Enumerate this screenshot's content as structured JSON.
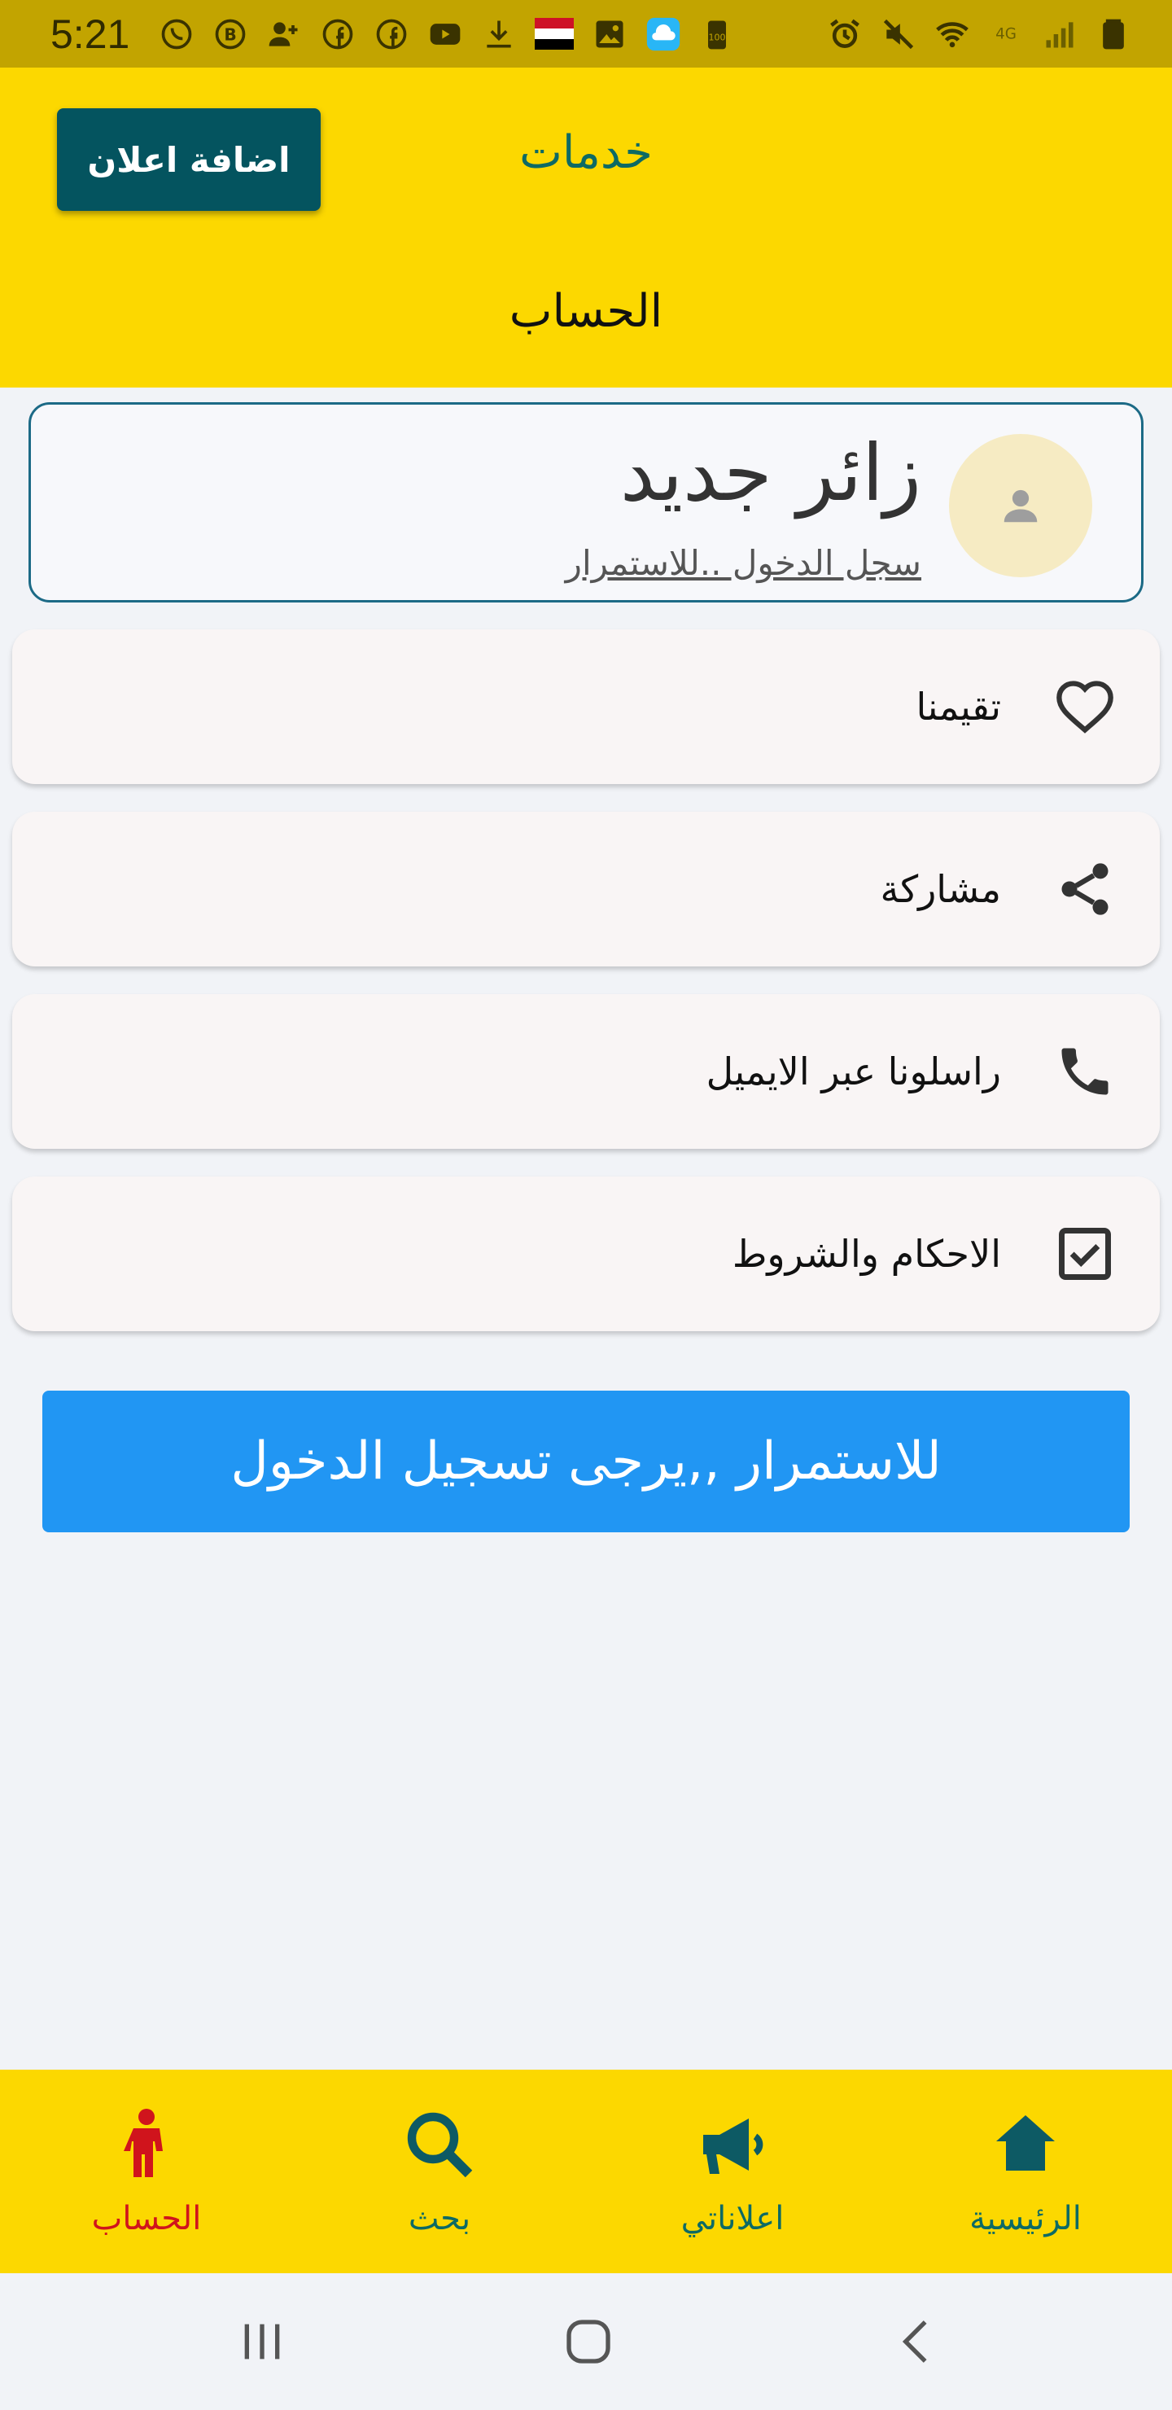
{
  "status_bar": {
    "time": "5:21",
    "left_icons": [
      "whatsapp-icon",
      "whatsapp-business-icon",
      "add-contact-icon",
      "facebook-icon",
      "facebook-icon",
      "youtube-icon",
      "download-icon",
      "yemen-flag-icon",
      "gallery-icon",
      "cloud-upload-icon",
      "battery-saver-icon"
    ],
    "right_icons": [
      "alarm-icon",
      "mute-icon",
      "wifi-icon",
      "4g-lte-icon",
      "signal-icon",
      "battery-icon"
    ],
    "battery_saver_label": "100",
    "network_label": "4G"
  },
  "header": {
    "add_ad_label": "اضافة اعلان",
    "services_label": "خدمات",
    "title": "الحساب"
  },
  "profile": {
    "name": "زائر جديد",
    "subtitle": "سجل الدخول ..للاستمرار",
    "avatar_icon": "person-icon"
  },
  "menu": {
    "items": [
      {
        "label": "تقيمنا",
        "icon": "heart-icon"
      },
      {
        "label": "مشاركة",
        "icon": "share-icon"
      },
      {
        "label": "راسلونا عبر الايميل",
        "icon": "phone-icon"
      },
      {
        "label": "الاحكام والشروط",
        "icon": "checkbox-icon"
      }
    ]
  },
  "login_button": {
    "label": "للاستمرار ,,يرجى تسجيل الدخول"
  },
  "bottom_nav": {
    "items": [
      {
        "label": "الرئيسية",
        "icon": "home-icon",
        "active": false
      },
      {
        "label": "اعلاناتي",
        "icon": "megaphone-icon",
        "active": false
      },
      {
        "label": "بحث",
        "icon": "search-icon",
        "active": false
      },
      {
        "label": "الحساب",
        "icon": "person-standing-icon",
        "active": true
      }
    ]
  },
  "colors": {
    "status_bar": "#c2a400",
    "header": "#fcd800",
    "primary_button": "#04545f",
    "login_button": "#2196f3",
    "nav_active": "#d0141c",
    "nav_inactive": "#0d6a64"
  }
}
